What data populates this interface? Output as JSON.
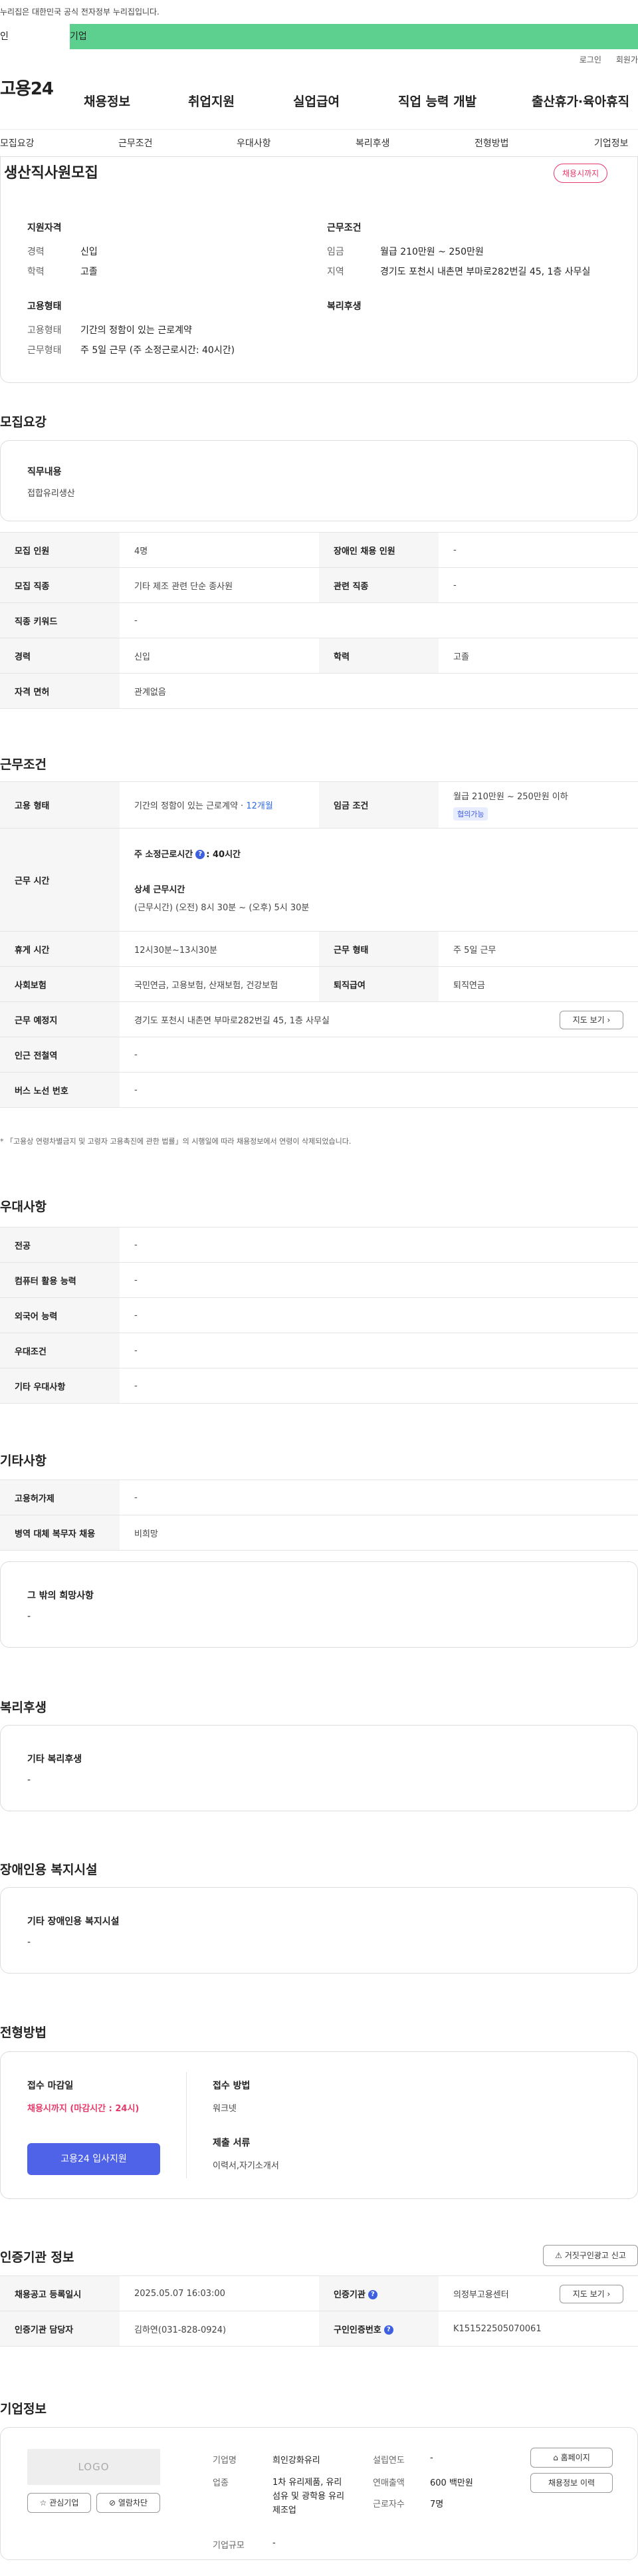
{
  "gov_banner": "누리집은 대한민국 공식 전자정부 누리집입니다.",
  "top_tabs": [
    "인",
    "기업"
  ],
  "util": [
    "로그인",
    "회원가"
  ],
  "logo": "고용24",
  "gnb": [
    "채용정보",
    "취업지원",
    "실업급여",
    "직업 능력 개발",
    "출산휴가·육아휴직"
  ],
  "subnav": [
    "모집요강",
    "근무조건",
    "우대사항",
    "복리후생",
    "전형방법",
    "기업정보"
  ],
  "header_card": {
    "title": "생산직사원모집",
    "badge": "채용시까지",
    "qual_h": "지원자격",
    "career_l": "경력",
    "career_v": "신입",
    "edu_l": "학력",
    "edu_v": "고졸",
    "cond_h": "근무조건",
    "wage_l": "임금",
    "wage_v": "월급 210만원 ~ 250만원",
    "region_l": "지역",
    "region_v": "경기도 포천시 내촌면 부마로282번길 45, 1층 사무실",
    "emp_h": "고용형태",
    "emptype_l": "고용형태",
    "emptype_v": "기간의 정함이 있는 근로계약",
    "worktype_l": "근무형태",
    "worktype_v": "주 5일 근무 (주 소정근로시간: 40시간)",
    "welfare_h": "복리후생"
  },
  "recruit": {
    "title": "모집요강",
    "duty_h": "직무내용",
    "duty_v": "접합유리생산",
    "rows": [
      {
        "h1": "모집 인원",
        "v1": "4명",
        "h2": "장애인 채용 인원",
        "v2": "-"
      },
      {
        "h1": "모집 직종",
        "v1": "기타 제조 관련 단순 종사원",
        "h2": "관련 직종",
        "v2": "-"
      },
      {
        "h1": "직종 키워드",
        "v1": "-"
      },
      {
        "h1": "경력",
        "v1": "신입",
        "h2": "학력",
        "v2": "고졸"
      },
      {
        "h1": "자격 면허",
        "v1": "관계없음"
      }
    ]
  },
  "work": {
    "title": "근무조건",
    "emp_h": "고용 형태",
    "emp_v": "기간의 정함이 있는 근로계약 · ",
    "emp_v2": "12개월",
    "wage_h": "임금 조건",
    "wage_v": "월급 210만원 ~ 250만원 이하",
    "wage_pill": "협의가능",
    "hours_h": "근무 시간",
    "hours_1": "주 소정근로시간",
    "hours_1v": ": 40시간",
    "hours_2": "상세 근무시간",
    "hours_3": "(근무시간) (오전) 8시 30분 ~ (오후) 5시 30분",
    "rest_h": "휴게 시간",
    "rest_v": "12시30분~13시30분",
    "form_h": "근무 형태",
    "form_v": "주 5일 근무",
    "ins_h": "사회보험",
    "ins_v": "국민연금, 고용보험, 산재보험, 건강보험",
    "ret_h": "퇴직급여",
    "ret_v": "퇴직연금",
    "place_h": "근무 예정지",
    "place_v": "경기도 포천시 내촌면 부마로282번길 45, 1층 사무실",
    "map_btn": "지도 보기",
    "subway_h": "인근 전철역",
    "subway_v": "-",
    "bus_h": "버스 노선 번호",
    "bus_v": "-",
    "note": "* 「고용상 연령차별금지 및 고령자 고용촉진에 관한 법률」의 시행일에 따라 채용정보에서 연령이 삭제되었습니다."
  },
  "pref": {
    "title": "우대사항",
    "rows": [
      {
        "h": "전공",
        "v": "-"
      },
      {
        "h": "컴퓨터 활용 능력",
        "v": "-"
      },
      {
        "h": "외국어 능력",
        "v": "-"
      },
      {
        "h": "우대조건",
        "v": "-"
      },
      {
        "h": "기타 우대사항",
        "v": "-"
      }
    ]
  },
  "etc": {
    "title": "기타사항",
    "rows": [
      {
        "h": "고용허가제",
        "v": "-"
      },
      {
        "h": "병역 대체 복무자 채용",
        "v": "비희망"
      }
    ],
    "other_h": "그 밖의 희망사항",
    "other_v": "-"
  },
  "welfare": {
    "title": "복리후생",
    "h": "기타 복리후생",
    "v": "-"
  },
  "disabled": {
    "title": "장애인용 복지시설",
    "h": "기타 장애인용 복지시설",
    "v": "-"
  },
  "process": {
    "title": "전형방법",
    "deadline_h": "접수 마감일",
    "deadline_v": "채용시까지 (마감시간 : 24시)",
    "apply_btn": "고용24 입사지원",
    "method_h": "접수 방법",
    "method_v": "워크넷",
    "docs_h": "제출 서류",
    "docs_v": "이력서,자기소개서"
  },
  "agency": {
    "title": "인증기관 정보",
    "report_btn": "거짓구인광고 신고",
    "reg_h": "채용공고 등록일시",
    "reg_v": "2025.05.07 16:03:00",
    "org_h": "인증기관",
    "org_v": "의정부고용센터",
    "map_btn": "지도 보기",
    "mgr_h": "인증기관 담당자",
    "mgr_v": "김하연(031-828-0924)",
    "num_h": "구인인증번호",
    "num_v": "K151522505070061"
  },
  "company": {
    "title": "기업정보",
    "logo": "LOGO",
    "fav_btn": "관심기업",
    "block_btn": "열람차단",
    "name_l": "기업명",
    "name_v": "희인강화유리",
    "ind_l": "업종",
    "ind_v": "1차 유리제품, 유리섬유 및 광학용 유리 제조업",
    "size_l": "기업규모",
    "size_v": "-",
    "year_l": "설립연도",
    "year_v": "-",
    "sales_l": "연매출액",
    "sales_v": "600 백만원",
    "emp_l": "근로자수",
    "emp_v": "7명",
    "home_btn": "홈페이지",
    "history_btn": "채용정보 이력"
  }
}
